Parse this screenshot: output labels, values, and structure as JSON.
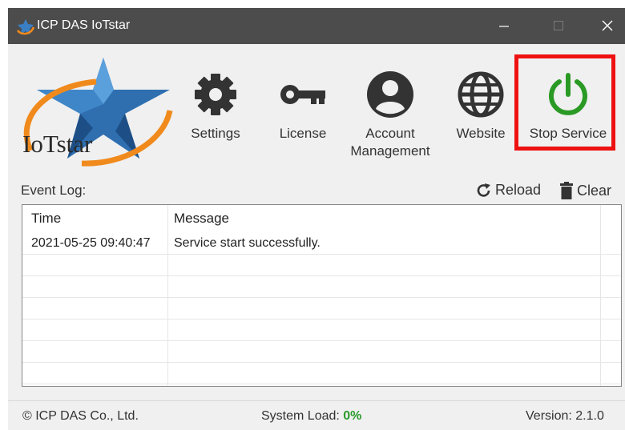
{
  "window": {
    "title": "ICP DAS IoTstar",
    "controls": {
      "minimize_icon": "minimize-icon",
      "maximize_icon": "maximize-icon",
      "close_icon": "close-icon"
    }
  },
  "logo": {
    "text": "IoTstar"
  },
  "toolbar": {
    "items": [
      {
        "label": "Settings",
        "icon": "gear-icon"
      },
      {
        "label": "License",
        "icon": "key-icon"
      },
      {
        "label": "Account Management",
        "icon": "user-icon"
      },
      {
        "label": "Website",
        "icon": "globe-icon"
      },
      {
        "label": "Stop Service",
        "icon": "power-icon"
      }
    ],
    "highlighted_item": "Stop Service",
    "colors": {
      "icon": "#333333",
      "power": "#2a9a25",
      "highlight": "#ee1111"
    }
  },
  "event_log": {
    "label": "Event Log:",
    "reload_label": "Reload",
    "clear_label": "Clear",
    "columns": [
      "Time",
      "Message"
    ],
    "rows": [
      {
        "time": "2021-05-25 09:40:47",
        "message": "Service start successfully."
      }
    ]
  },
  "status": {
    "copyright": "© ICP DAS Co., Ltd.",
    "system_load_label": "System Load:",
    "system_load_value": "0%",
    "version": "Version: 2.1.0",
    "load_color": "#2b9a2b"
  }
}
